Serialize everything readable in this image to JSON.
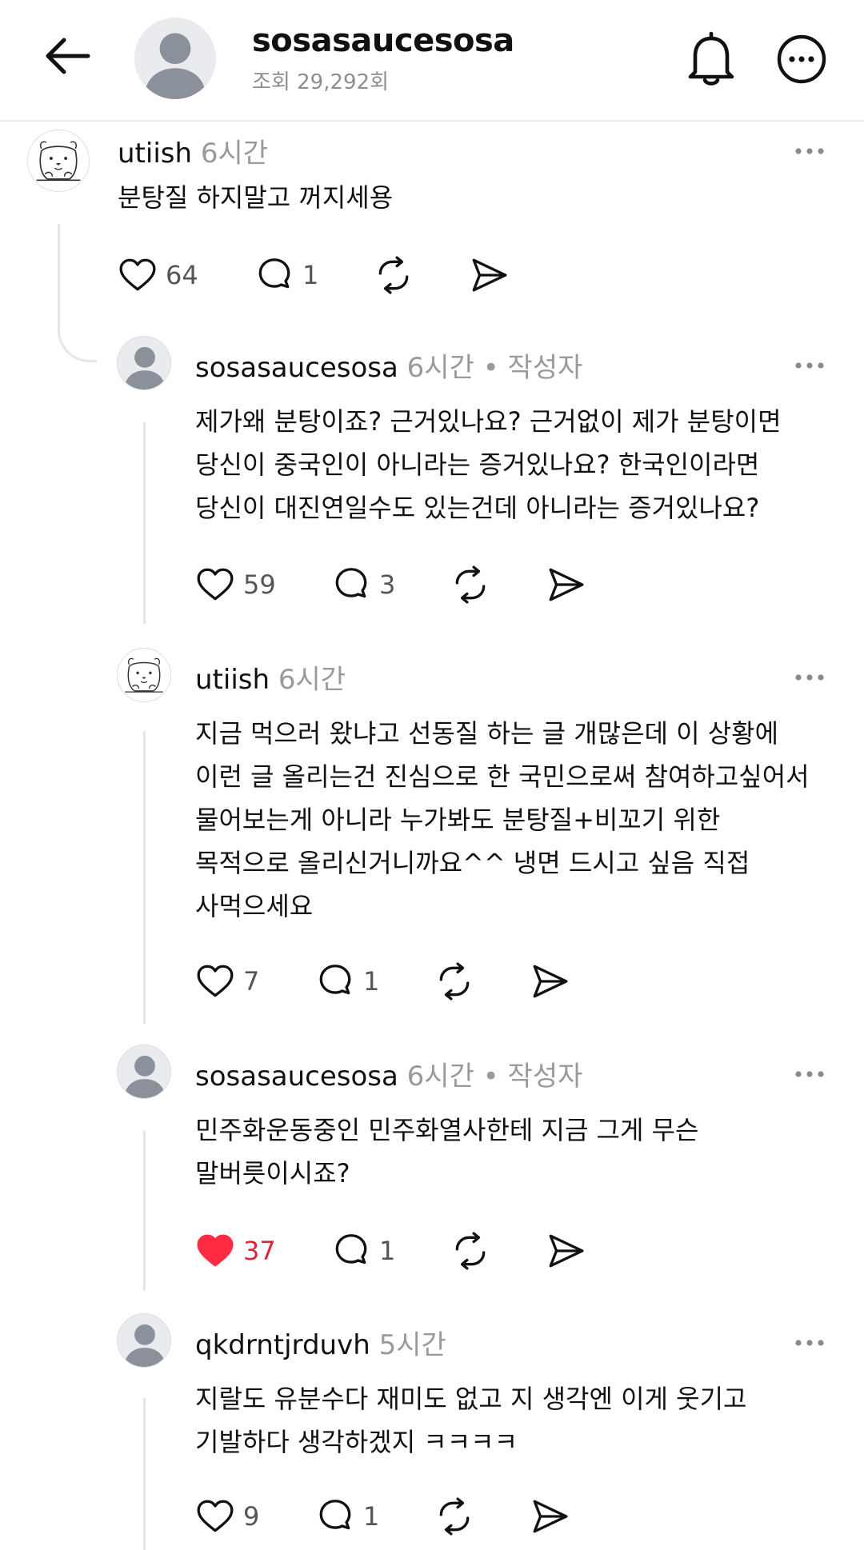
{
  "header": {
    "title": "sosasaucesosa",
    "views": "조회 29,292회"
  },
  "comments": [
    {
      "user": "utiish",
      "time": "6시간",
      "author_tag": "",
      "text": "분탕질 하지말고 꺼지세용",
      "likes": "64",
      "replies": "1",
      "liked": false
    },
    {
      "user": "sosasaucesosa",
      "time": "6시간",
      "author_tag": "• 작성자",
      "text_lines": [
        "제가왜 분탕이죠? 근거있나요? 근거없이 제가 분탕이면",
        "당신이 중국인이 아니라는 증거있나요? 한국인이라면",
        "당신이 대진연일수도 있는건데 아니라는 증거있나요?"
      ],
      "likes": "59",
      "replies": "3",
      "liked": false
    },
    {
      "user": "utiish",
      "time": "6시간",
      "author_tag": "",
      "text_lines": [
        "지금 먹으러 왔냐고 선동질 하는 글 개많은데 이 상황에",
        "이런 글 올리는건 진심으로 한 국민으로써 참여하고싶어서",
        "물어보는게 아니라 누가봐도 분탕질+비꼬기 위한",
        "목적으로 올리신거니까요^^ 냉면 드시고 싶음 직접",
        "사먹으세요"
      ],
      "likes": "7",
      "replies": "1",
      "liked": false
    },
    {
      "user": "sosasaucesosa",
      "time": "6시간",
      "author_tag": "• 작성자",
      "text_lines": [
        "민주화운동중인 민주화열사한테 지금 그게 무슨",
        "말버릇이시죠?"
      ],
      "likes": "37",
      "replies": "1",
      "liked": true
    },
    {
      "user": "qkdrntjrduvh",
      "time": "5시간",
      "author_tag": "",
      "text_lines": [
        "지랄도 유분수다 재미도 없고 지 생각엔 이게 웃기고",
        "기발하다 생각하겠지 ㅋㅋㅋㅋ"
      ],
      "likes": "9",
      "replies": "1",
      "liked": false
    }
  ],
  "colors": {
    "like_active": "#e0243b",
    "meta": "#9a9a9a",
    "icon": "#111111"
  },
  "icons": [
    "back-arrow-icon",
    "bell-icon",
    "more-icon",
    "heart-icon",
    "comment-icon",
    "repost-icon",
    "share-icon"
  ]
}
